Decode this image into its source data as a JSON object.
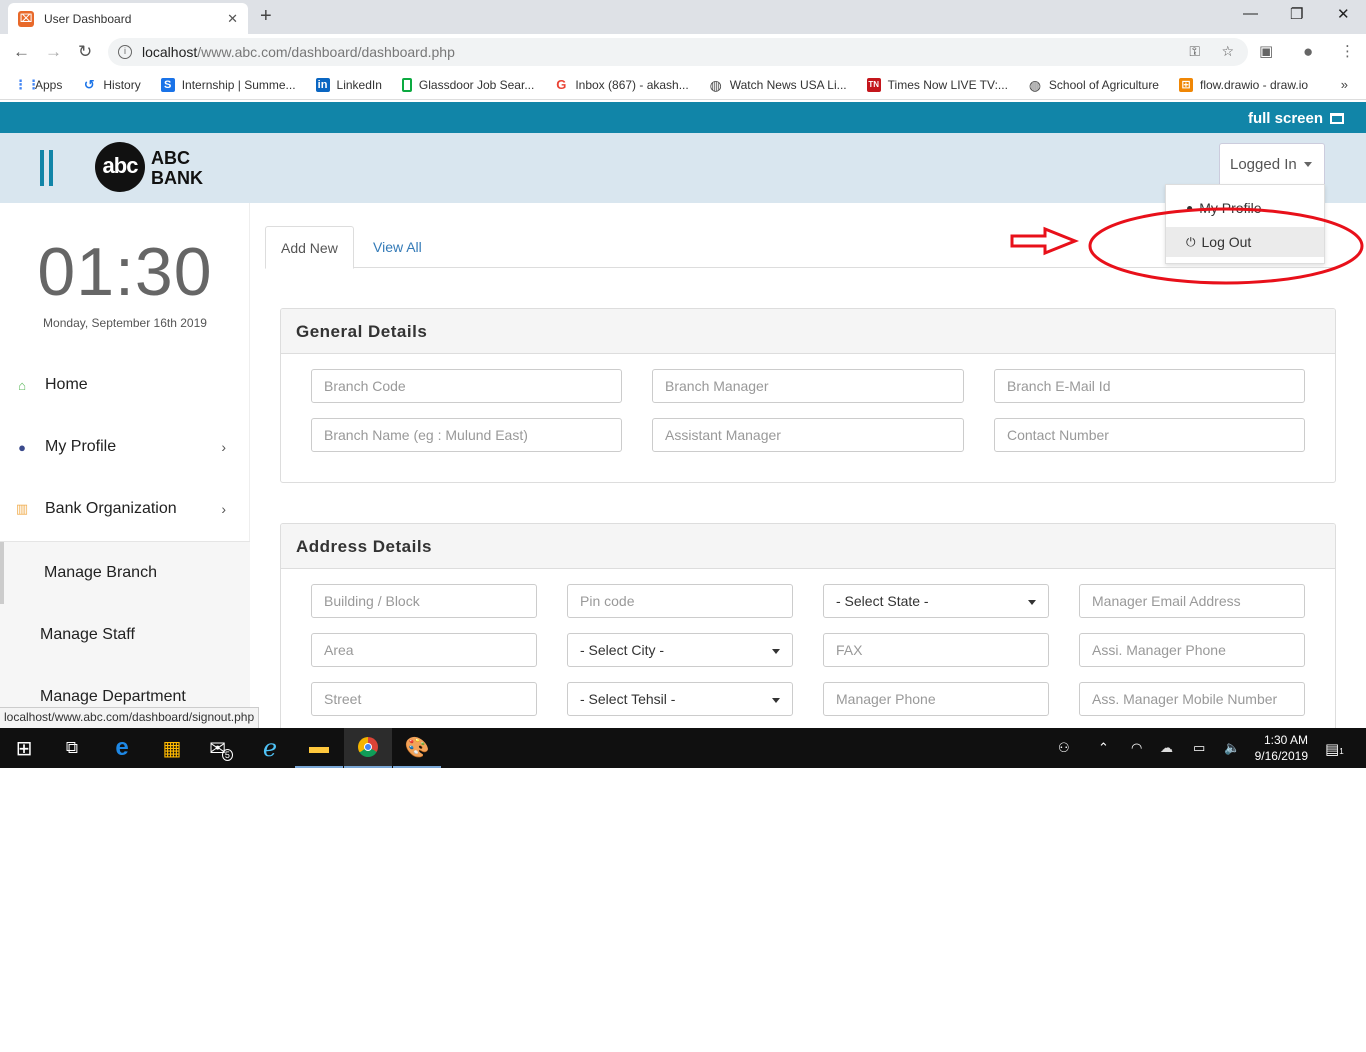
{
  "browser": {
    "tab_title": "User Dashboard",
    "url_host": "localhost",
    "url_path": "/www.abc.com/dashboard/dashboard.php",
    "bookmarks": [
      {
        "label": "Apps",
        "icon": "apps-grid-icon",
        "color": "#4285f4"
      },
      {
        "label": "History",
        "icon": "history-icon",
        "color": "#1a73e8"
      },
      {
        "label": "Internship | Summe...",
        "icon": "internshala-icon",
        "color": "#1a73e8"
      },
      {
        "label": "LinkedIn",
        "icon": "linkedin-icon",
        "color": "#0a66c2"
      },
      {
        "label": "Glassdoor Job Sear...",
        "icon": "glassdoor-icon",
        "color": "#0caa41"
      },
      {
        "label": "Inbox (867) - akash...",
        "icon": "google-icon",
        "color": "#ea4335"
      },
      {
        "label": "Watch News USA Li...",
        "icon": "globe-icon",
        "color": "#444444"
      },
      {
        "label": "Times Now LIVE TV:...",
        "icon": "times-now-icon",
        "color": "#c4161c"
      },
      {
        "label": "School of Agriculture",
        "icon": "globe-icon",
        "color": "#444444"
      },
      {
        "label": "flow.drawio - draw.io",
        "icon": "drawio-icon",
        "color": "#f08705"
      }
    ]
  },
  "app": {
    "fullscreen_label": "full screen",
    "logo_mark": "abc",
    "logo_line1": "ABC",
    "logo_line2": "BANK",
    "user_menu_label": "Logged In",
    "user_menu_items": [
      "My Profile",
      "Log Out"
    ],
    "status_url": "localhost/www.abc.com/dashboard/signout.php"
  },
  "sidebar": {
    "time": "01:30",
    "date": "Monday, September 16th 2019",
    "items": [
      {
        "label": "Home",
        "icon": "home-icon",
        "color": "#5cb85c"
      },
      {
        "label": "My Profile",
        "icon": "user-icon",
        "color": "#3b4a8c"
      },
      {
        "label": "Bank Organization",
        "icon": "building-icon",
        "color": "#f0ad4e"
      }
    ],
    "submenu": [
      "Manage Branch",
      "Manage Staff",
      "Manage Department"
    ]
  },
  "main": {
    "tabs": [
      "Add New",
      "View All"
    ],
    "general": {
      "title": "General Details",
      "fields": [
        "Branch Code",
        "Branch Manager",
        "Branch E-Mail Id",
        "Branch Name (eg : Mulund East)",
        "Assistant Manager",
        "Contact Number"
      ]
    },
    "address": {
      "title": "Address Details",
      "fields": [
        "Building / Block",
        "Pin code",
        "- Select State -",
        "Manager Email Address",
        "Area",
        "- Select City -",
        "FAX",
        "Assi. Manager Phone",
        "Street",
        "- Select Tehsil -",
        "Manager Phone",
        "Ass. Manager Mobile Number"
      ]
    }
  },
  "taskbar": {
    "time": "1:30 AM",
    "date": "9/16/2019",
    "mail_badge": "5",
    "notification_badge": "1"
  },
  "colors": {
    "accent": "#1185a8",
    "header_bg": "#d9e6ef",
    "annotation": "#e8101a"
  }
}
